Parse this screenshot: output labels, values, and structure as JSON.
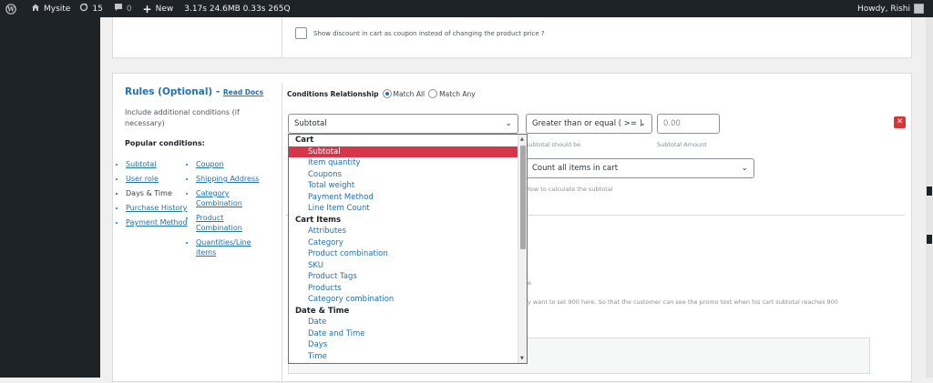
{
  "admin_bar": {
    "site": "Mysite",
    "updates": "15",
    "comments": "0",
    "new": "New",
    "perf": "3.17s  24.6MB  0.33s  265Q",
    "howdy": "Howdy, Rishi"
  },
  "top_panel": {
    "checkbox_label": "Show discount in cart as coupon instead of changing the product price ?"
  },
  "rules": {
    "title": "Rules (Optional) -",
    "read_docs": "Read Docs",
    "description": "Include additional conditions (if necessary)",
    "popular_label": "Popular conditions:",
    "left_links": [
      "Subtotal",
      "User role",
      "Days & Time",
      "Purchase History",
      "Payment Method"
    ],
    "right_links": [
      "Coupon",
      "Shipping Address",
      "Category Combination",
      "Product Combination",
      "Quantities/Line items"
    ]
  },
  "conditions": {
    "relationship_label": "Conditions Relationship",
    "match_all": "Match All",
    "match_any": "Match Any",
    "type_value": "Subtotal",
    "operator_value": "Greater than or equal ( >= )",
    "amount_placeholder": "0.00",
    "operator_hint": "subtotal should be",
    "amount_hint": "Subtotal Amount",
    "calc_value": "Count all items in cart",
    "calc_hint": "How to calculate the subtotal",
    "partial_text_1": "e",
    "partial_text_2": "y want to set 900 here. So that the customer can see the promo text when his cart subtotal reaches 900"
  },
  "dropdown": {
    "groups": [
      {
        "label": "Cart",
        "items": [
          "Subtotal",
          "Item quantity",
          "Coupons",
          "Total weight",
          "Payment Method",
          "Line Item Count"
        ]
      },
      {
        "label": "Cart Items",
        "items": [
          "Attributes",
          "Category",
          "Product combination",
          "SKU",
          "Product Tags",
          "Products",
          "Category combination"
        ]
      },
      {
        "label": "Date & Time",
        "items": [
          "Date",
          "Date and Time",
          "Days",
          "Time"
        ]
      }
    ],
    "selected": "Subtotal"
  },
  "colors": {
    "accent": "#2271b1",
    "selected": "#d63649",
    "danger": "#d63638",
    "adminbar": "#1d2327"
  }
}
